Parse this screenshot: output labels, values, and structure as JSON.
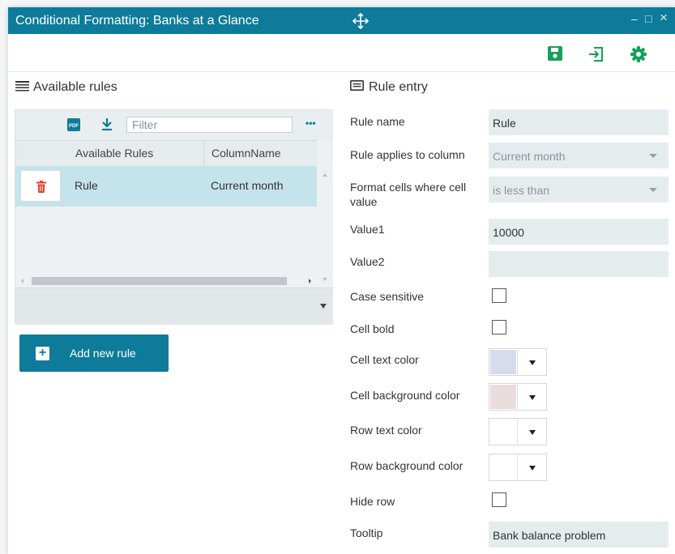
{
  "window": {
    "title": "Conditional Formatting: Banks at a Glance",
    "controls": {
      "minimize": "–",
      "maximize": "□",
      "close": "×"
    }
  },
  "toolbar": {
    "icons": [
      "save-icon",
      "exit-icon",
      "gear-icon"
    ],
    "accent_color": "#16a05a"
  },
  "left": {
    "section_title": "Available rules",
    "grid": {
      "filter_placeholder": "Filter",
      "more": "•••",
      "columns": [
        "Available Rules",
        "ColumnName"
      ],
      "rows": [
        {
          "rule": "Rule",
          "column": "Current month"
        }
      ]
    },
    "add_button": "Add new rule"
  },
  "right": {
    "section_title": "Rule entry",
    "fields": {
      "rule_name": {
        "label": "Rule name",
        "value": "Rule"
      },
      "applies_to": {
        "label": "Rule applies to column",
        "value": "Current month"
      },
      "condition": {
        "label": "Format cells where cell value",
        "value": "is less than"
      },
      "value1": {
        "label": "Value1",
        "value": "10000"
      },
      "value2": {
        "label": "Value2",
        "value": ""
      },
      "case_sensitive": {
        "label": "Case sensitive",
        "checked": false
      },
      "cell_bold": {
        "label": "Cell bold",
        "checked": false
      },
      "cell_text_color": {
        "label": "Cell text color",
        "color": "#d7dcec"
      },
      "cell_bg_color": {
        "label": "Cell background color",
        "color": "#e8dcdc"
      },
      "row_text_color": {
        "label": "Row text color",
        "color": "#ffffff"
      },
      "row_bg_color": {
        "label": "Row background color",
        "color": "#ffffff"
      },
      "hide_row": {
        "label": "Hide row",
        "checked": false
      },
      "tooltip": {
        "label": "Tooltip",
        "value": "Bank balance problem"
      }
    }
  },
  "colors": {
    "titlebar": "#0e7b9a",
    "selected_row": "#c5e3ea",
    "trash": "#e0452c",
    "field_bg": "#e5ecee"
  }
}
